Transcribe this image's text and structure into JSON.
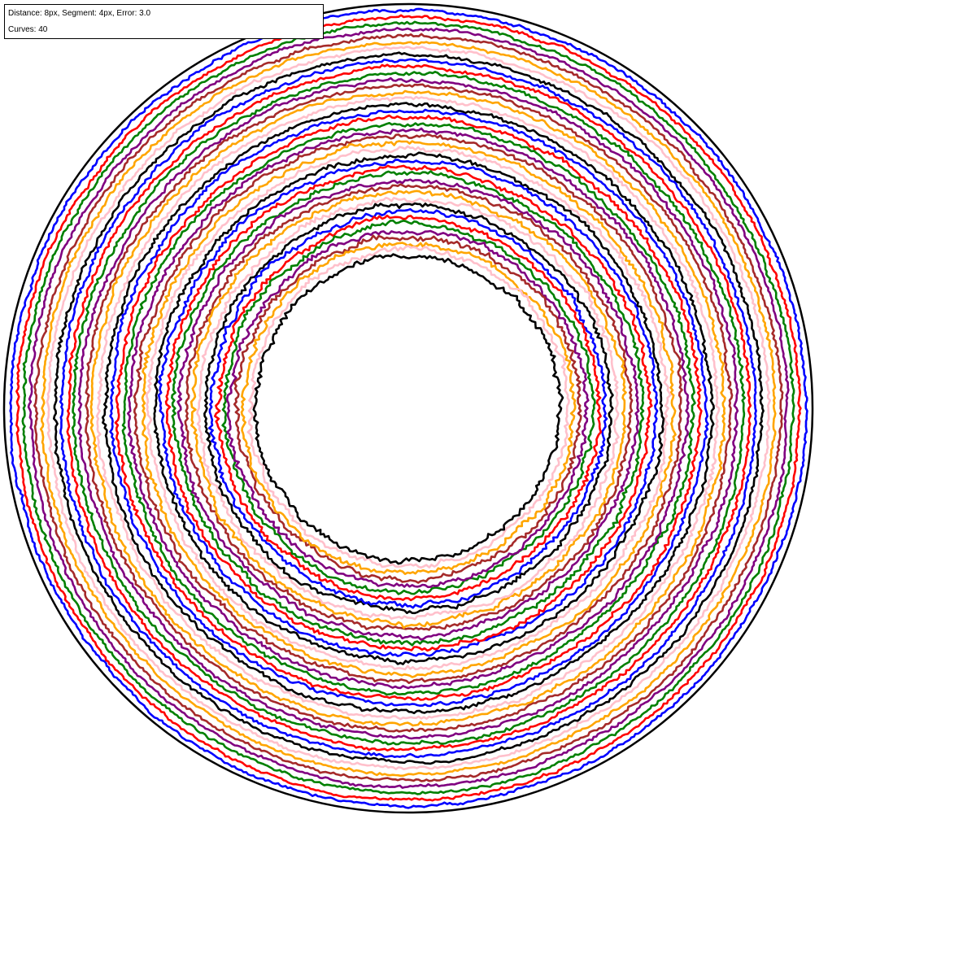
{
  "info_panel": {
    "line1": "Distance: 8px, Segment: 4px, Error: 3.0",
    "line2": "Curves: 40"
  },
  "figure": {
    "outer_boundary_color": "#000000",
    "curve_count": 40,
    "curve_colors": [
      "#0000ff",
      "#ff0000",
      "#008000",
      "#800080",
      "#a52a2a",
      "#ffa500",
      "#ffc0cb",
      "#000000"
    ]
  }
}
